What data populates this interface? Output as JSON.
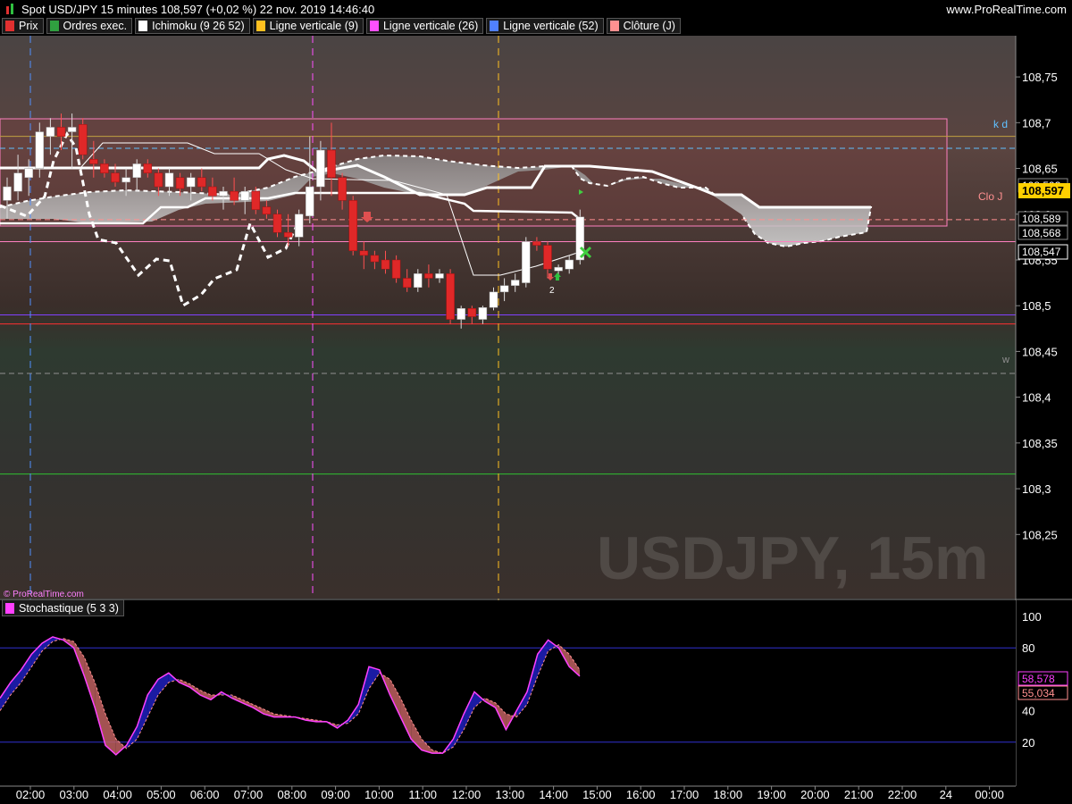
{
  "header": {
    "title": "Spot USD/JPY 15 minutes 108,597 (+0,02 %) 22 nov. 2019 14:46:40",
    "site": "www.ProRealTime.com"
  },
  "legend": [
    {
      "label": "Prix",
      "color": "#e03030"
    },
    {
      "label": "Ordres exec.",
      "color": "#30a040"
    },
    {
      "label": "Ichimoku (9 26 52)",
      "color": "#ffffff"
    },
    {
      "label": "Ligne verticale (9)",
      "color": "#ffc020"
    },
    {
      "label": "Ligne verticale (26)",
      "color": "#ff50ff"
    },
    {
      "label": "Ligne verticale (52)",
      "color": "#5080ff"
    },
    {
      "label": "Clôture (J)",
      "color": "#ff9090"
    }
  ],
  "watermark": "USDJPY, 15m",
  "copyright": "© ProRealTime.com",
  "labels": {
    "kd": "k d",
    "clo": "Clo J",
    "w": "w",
    "two": "2"
  },
  "price_tags": {
    "current": "108,597",
    "a": "108,593",
    "b": "108,589",
    "c": "108,568",
    "d": "108,547"
  },
  "stoch_tags": {
    "k": "58,578",
    "d": "55,034"
  },
  "chart_data": [
    {
      "type": "candlestick",
      "title": "Spot USD/JPY 15 minutes",
      "ylim": [
        108.18,
        108.795
      ],
      "yticks": [
        "108,75",
        "108,7",
        "108,65",
        "108,6",
        "108,55",
        "108,5",
        "108,45",
        "108,4",
        "108,35",
        "108,3",
        "108,25"
      ],
      "ytick_values": [
        108.75,
        108.7,
        108.65,
        108.6,
        108.55,
        108.5,
        108.45,
        108.4,
        108.35,
        108.3,
        108.25
      ],
      "x_labels": [
        "02:00",
        "03:00",
        "04:00",
        "05:00",
        "06:00",
        "07:00",
        "08:00",
        "09:00",
        "10:00",
        "11:00",
        "12:00",
        "13:00",
        "14:00",
        "15:00",
        "16:00",
        "17:00",
        "18:00",
        "19:00",
        "20:00",
        "21:00",
        "22:00",
        "24",
        "00:00"
      ],
      "candles": [
        {
          "o": 108.615,
          "h": 108.64,
          "l": 108.595,
          "c": 108.63
        },
        {
          "o": 108.625,
          "h": 108.665,
          "l": 108.615,
          "c": 108.645
        },
        {
          "o": 108.64,
          "h": 108.66,
          "l": 108.62,
          "c": 108.65
        },
        {
          "o": 108.65,
          "h": 108.7,
          "l": 108.64,
          "c": 108.69
        },
        {
          "o": 108.685,
          "h": 108.705,
          "l": 108.665,
          "c": 108.695
        },
        {
          "o": 108.695,
          "h": 108.71,
          "l": 108.67,
          "c": 108.685
        },
        {
          "o": 108.69,
          "h": 108.71,
          "l": 108.65,
          "c": 108.695
        },
        {
          "o": 108.698,
          "h": 108.705,
          "l": 108.66,
          "c": 108.665
        },
        {
          "o": 108.66,
          "h": 108.68,
          "l": 108.64,
          "c": 108.655
        },
        {
          "o": 108.655,
          "h": 108.66,
          "l": 108.64,
          "c": 108.645
        },
        {
          "o": 108.645,
          "h": 108.655,
          "l": 108.63,
          "c": 108.635
        },
        {
          "o": 108.635,
          "h": 108.65,
          "l": 108.62,
          "c": 108.64
        },
        {
          "o": 108.64,
          "h": 108.66,
          "l": 108.625,
          "c": 108.655
        },
        {
          "o": 108.655,
          "h": 108.66,
          "l": 108.64,
          "c": 108.645
        },
        {
          "o": 108.645,
          "h": 108.65,
          "l": 108.62,
          "c": 108.63
        },
        {
          "o": 108.63,
          "h": 108.65,
          "l": 108.62,
          "c": 108.645
        },
        {
          "o": 108.64,
          "h": 108.645,
          "l": 108.62,
          "c": 108.628
        },
        {
          "o": 108.63,
          "h": 108.645,
          "l": 108.615,
          "c": 108.64
        },
        {
          "o": 108.64,
          "h": 108.65,
          "l": 108.625,
          "c": 108.63
        },
        {
          "o": 108.63,
          "h": 108.64,
          "l": 108.615,
          "c": 108.62
        },
        {
          "o": 108.62,
          "h": 108.63,
          "l": 108.605,
          "c": 108.625
        },
        {
          "o": 108.625,
          "h": 108.64,
          "l": 108.61,
          "c": 108.615
        },
        {
          "o": 108.615,
          "h": 108.63,
          "l": 108.6,
          "c": 108.625
        },
        {
          "o": 108.625,
          "h": 108.63,
          "l": 108.6,
          "c": 108.605
        },
        {
          "o": 108.608,
          "h": 108.615,
          "l": 108.595,
          "c": 108.6
        },
        {
          "o": 108.6,
          "h": 108.605,
          "l": 108.575,
          "c": 108.58
        },
        {
          "o": 108.58,
          "h": 108.6,
          "l": 108.565,
          "c": 108.575
        },
        {
          "o": 108.575,
          "h": 108.605,
          "l": 108.565,
          "c": 108.6
        },
        {
          "o": 108.598,
          "h": 108.685,
          "l": 108.59,
          "c": 108.63
        },
        {
          "o": 108.63,
          "h": 108.68,
          "l": 108.615,
          "c": 108.67
        },
        {
          "o": 108.67,
          "h": 108.7,
          "l": 108.62,
          "c": 108.64
        },
        {
          "o": 108.64,
          "h": 108.645,
          "l": 108.605,
          "c": 108.615
        },
        {
          "o": 108.615,
          "h": 108.62,
          "l": 108.555,
          "c": 108.56
        },
        {
          "o": 108.56,
          "h": 108.57,
          "l": 108.54,
          "c": 108.555
        },
        {
          "o": 108.555,
          "h": 108.56,
          "l": 108.54,
          "c": 108.548
        },
        {
          "o": 108.55,
          "h": 108.56,
          "l": 108.535,
          "c": 108.54
        },
        {
          "o": 108.55,
          "h": 108.555,
          "l": 108.525,
          "c": 108.53
        },
        {
          "o": 108.53,
          "h": 108.54,
          "l": 108.515,
          "c": 108.52
        },
        {
          "o": 108.52,
          "h": 108.54,
          "l": 108.515,
          "c": 108.535
        },
        {
          "o": 108.535,
          "h": 108.545,
          "l": 108.52,
          "c": 108.53
        },
        {
          "o": 108.53,
          "h": 108.54,
          "l": 108.525,
          "c": 108.535
        },
        {
          "o": 108.535,
          "h": 108.54,
          "l": 108.48,
          "c": 108.485
        },
        {
          "o": 108.485,
          "h": 108.5,
          "l": 108.475,
          "c": 108.497
        },
        {
          "o": 108.497,
          "h": 108.5,
          "l": 108.48,
          "c": 108.488
        },
        {
          "o": 108.485,
          "h": 108.5,
          "l": 108.48,
          "c": 108.498
        },
        {
          "o": 108.498,
          "h": 108.52,
          "l": 108.495,
          "c": 108.515
        },
        {
          "o": 108.515,
          "h": 108.53,
          "l": 108.505,
          "c": 108.522
        },
        {
          "o": 108.522,
          "h": 108.535,
          "l": 108.515,
          "c": 108.528
        },
        {
          "o": 108.525,
          "h": 108.575,
          "l": 108.52,
          "c": 108.57
        },
        {
          "o": 108.57,
          "h": 108.575,
          "l": 108.56,
          "c": 108.566
        },
        {
          "o": 108.566,
          "h": 108.57,
          "l": 108.53,
          "c": 108.54
        },
        {
          "o": 108.538,
          "h": 108.545,
          "l": 108.53,
          "c": 108.542
        },
        {
          "o": 108.54,
          "h": 108.555,
          "l": 108.535,
          "c": 108.55
        },
        {
          "o": 108.55,
          "h": 108.605,
          "l": 108.545,
          "c": 108.597
        }
      ],
      "horizontal_lines": [
        {
          "y": 108.685,
          "color": "#c0a040",
          "label": "k d"
        },
        {
          "y": 108.672,
          "color": "#60c0ff",
          "dash": true
        },
        {
          "y": 108.594,
          "color": "#ff9090",
          "dash": true,
          "label": "Clo J"
        },
        {
          "y": 108.57,
          "color": "#ff80c0"
        },
        {
          "y": 108.49,
          "color": "#8040ff"
        },
        {
          "y": 108.48,
          "color": "#ff3030"
        },
        {
          "y": 108.426,
          "color": "#909090",
          "dash": true,
          "label": "w"
        },
        {
          "y": 108.316,
          "color": "#30c030"
        }
      ]
    },
    {
      "type": "line",
      "title": "Stochastique (5 3 3)",
      "ylim": [
        0,
        100
      ],
      "yticks": [
        "100",
        "80",
        "60",
        "40",
        "20"
      ],
      "ytick_values": [
        100,
        80,
        60,
        40,
        20
      ],
      "reference_lines": [
        80,
        20
      ],
      "series": [
        {
          "values": [
            48,
            58,
            66,
            76,
            83,
            87,
            85,
            80,
            62,
            42,
            18,
            12,
            18,
            30,
            50,
            60,
            64,
            58,
            55,
            50,
            47,
            52,
            48,
            45,
            42,
            38,
            36,
            36,
            36,
            34,
            33,
            33,
            29,
            34,
            44,
            68,
            66,
            50,
            36,
            22,
            15,
            13,
            13,
            22,
            38,
            52,
            46,
            42,
            28,
            40,
            52,
            76,
            85,
            80,
            68,
            62
          ]
        },
        {
          "values": [
            40,
            50,
            58,
            68,
            78,
            84,
            86,
            84,
            74,
            58,
            38,
            22,
            16,
            22,
            36,
            50,
            58,
            60,
            57,
            53,
            50,
            50,
            50,
            47,
            44,
            41,
            38,
            37,
            36,
            35,
            34,
            33,
            31,
            32,
            38,
            54,
            64,
            60,
            48,
            34,
            22,
            15,
            13,
            17,
            28,
            42,
            48,
            45,
            38,
            36,
            44,
            62,
            78,
            82,
            76,
            66
          ]
        }
      ]
    }
  ]
}
